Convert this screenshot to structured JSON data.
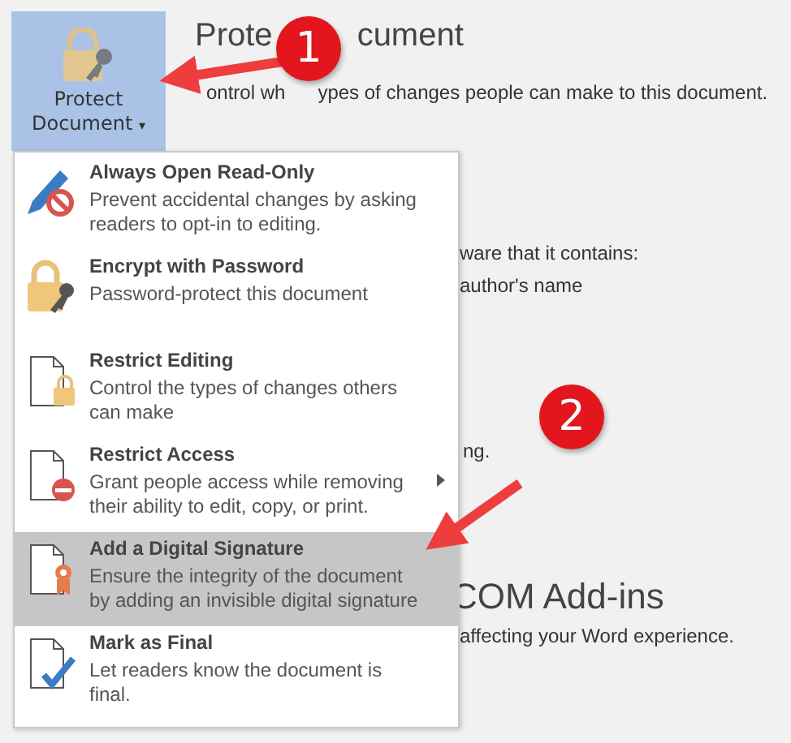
{
  "protect_button": {
    "label_line_1": "Protect",
    "label_line_2": "Document",
    "caret": "▾",
    "selected": true
  },
  "section": {
    "title_fragments": [
      "Prote",
      "cument"
    ],
    "description_fragments": [
      "ontrol wh",
      "ypes of changes people can make to this document."
    ]
  },
  "background_fragments": [
    {
      "kind": "text",
      "text": "ware that it contains:"
    },
    {
      "kind": "text",
      "text": "author's name"
    },
    {
      "kind": "text",
      "text": "ng."
    },
    {
      "kind": "heading",
      "text": "COM Add-ins"
    },
    {
      "kind": "text",
      "text": "affecting your Word experience."
    }
  ],
  "menu": {
    "items": [
      {
        "kind": "read-only",
        "title": "Always Open Read-Only",
        "description": "Prevent accidental changes by asking readers to opt-in to editing.",
        "selected": false,
        "has_submenu": false
      },
      {
        "kind": "encrypt",
        "title": "Encrypt with Password",
        "description": "Password-protect this document",
        "selected": false,
        "has_submenu": false
      },
      {
        "kind": "restrict-editing",
        "title": "Restrict Editing",
        "description": "Control the types of changes others can make",
        "selected": false,
        "has_submenu": false
      },
      {
        "kind": "restrict-access",
        "title": "Restrict Access",
        "description": "Grant people access while removing their ability to edit, copy, or print.",
        "selected": false,
        "has_submenu": true
      },
      {
        "kind": "signature",
        "title": "Add a Digital Signature",
        "description": "Ensure the integrity of the document by adding an invisible digital signature",
        "selected": true,
        "has_submenu": false
      },
      {
        "kind": "final",
        "title": "Mark as Final",
        "description": "Let readers know the document is final.",
        "selected": false,
        "has_submenu": false
      }
    ]
  },
  "annotations": [
    {
      "number": "1"
    },
    {
      "number": "2"
    }
  ]
}
